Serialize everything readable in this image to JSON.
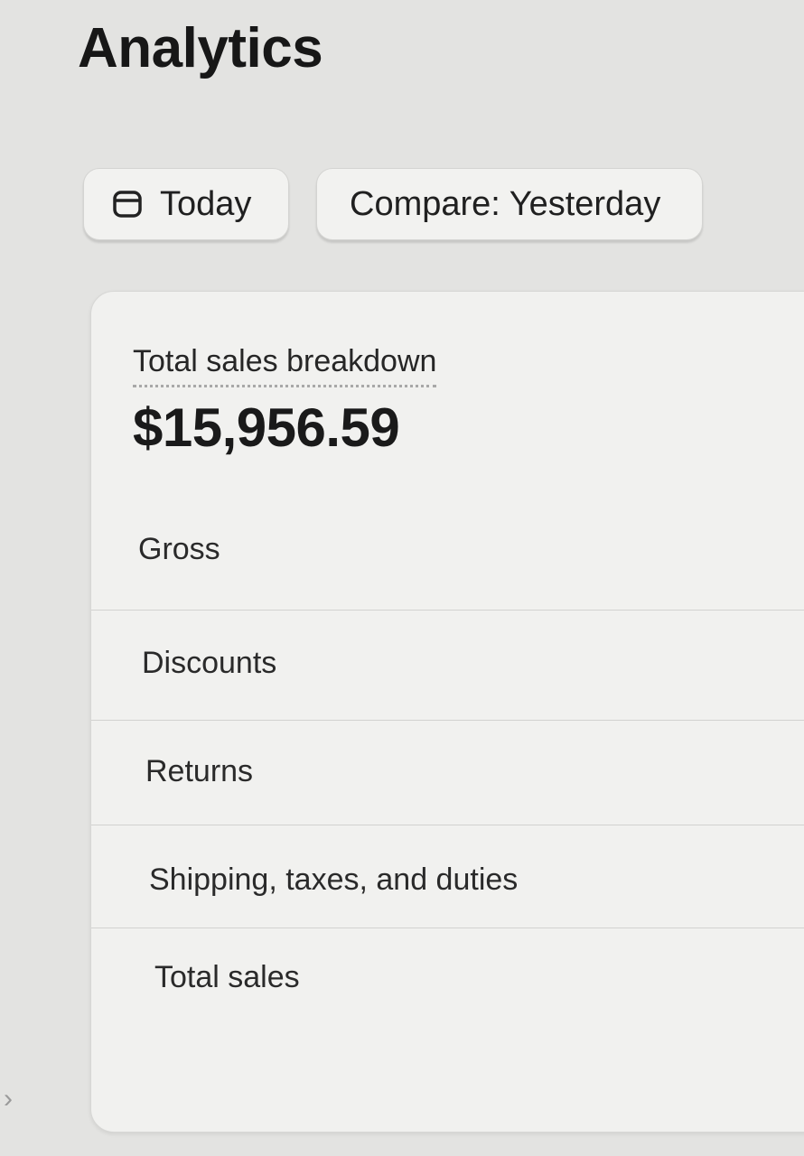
{
  "header": {
    "title": "Analytics"
  },
  "filters": {
    "date_label": "Today",
    "date_icon": "calendar-icon",
    "compare_label": "Compare: Yesterday"
  },
  "card": {
    "title": "Total sales breakdown",
    "value": "$15,956.59",
    "rows": [
      {
        "label": "Gross"
      },
      {
        "label": "Discounts"
      },
      {
        "label": "Returns"
      },
      {
        "label": "Shipping, taxes, and duties"
      },
      {
        "label": "Total sales"
      }
    ]
  },
  "sidebar": {
    "expand_glyph": "›"
  }
}
